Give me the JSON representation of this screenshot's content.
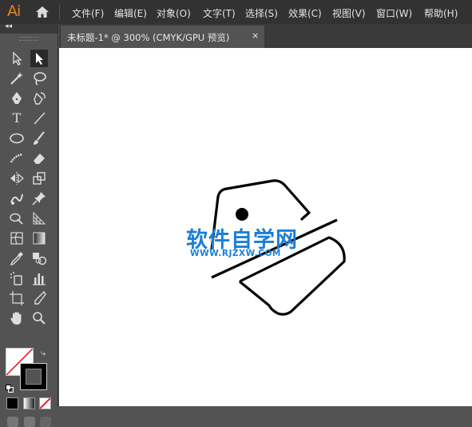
{
  "app": {
    "logo": "Ai"
  },
  "menu": {
    "items": [
      "文件(F)",
      "编辑(E)",
      "对象(O)",
      "文字(T)",
      "选择(S)",
      "效果(C)",
      "视图(V)",
      "窗口(W)",
      "帮助(H)"
    ]
  },
  "tab": {
    "title": "未标题-1* @ 300% (CMYK/GPU 预览)",
    "close": "×"
  },
  "toolbar": {
    "collapse": "◂◂"
  },
  "watermark": {
    "text": "软件自学网",
    "url": "WWW.RJZXW.COM"
  },
  "colors": {
    "accent": "#e8802d",
    "watermark": "#1b7fd6",
    "canvas": "#ffffff",
    "panel": "#535353"
  }
}
